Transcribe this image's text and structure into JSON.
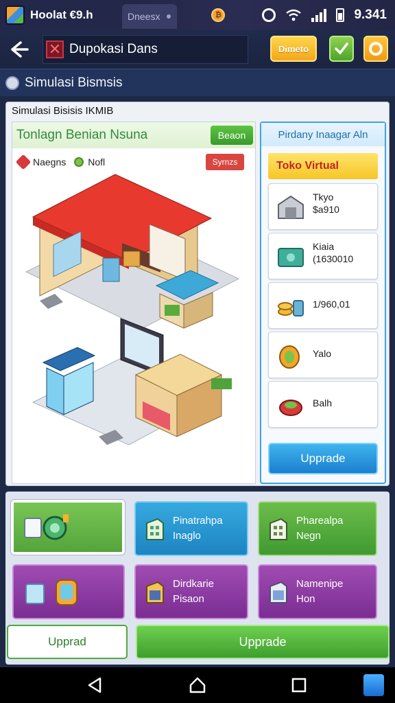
{
  "status_bar": {
    "app_tab_label": "Hoolat €9.h",
    "second_tab_label": "Dneesx",
    "coin_symbol": "₿",
    "clock": "9.341",
    "icons": [
      "coin-icon",
      "ring-icon",
      "wifi-icon",
      "signal-icon",
      "battery-icon"
    ]
  },
  "header": {
    "back_icon": "back-arrow-icon",
    "title": "Dupokasi Dans",
    "yellow_button_label": "Dimeto",
    "green_button_icon": "check-download-icon",
    "orange_button_icon": "settings-icon"
  },
  "section": {
    "title": "Simulasi Bismsis"
  },
  "main_panel": {
    "title": "Simulasi Bisisis IKMIB",
    "scene": {
      "title": "Tonlagn Benian Nsuna",
      "action_button": "Beaon",
      "legend_left": "Naegns",
      "legend_right": "Nofl",
      "badge": "Syrnzs"
    },
    "side": {
      "header": "Pirdany Inaagar Aln",
      "tag": "Toko Virtual",
      "cards": [
        {
          "line1": "Tkyo",
          "line2": "$a910",
          "icon": "warehouse-icon"
        },
        {
          "line1": "Kiaia",
          "line2": "(1630010",
          "icon": "cash-icon"
        },
        {
          "line1": "1/960,01",
          "line2": "",
          "icon": "coins-icon"
        },
        {
          "line1": "Yalo",
          "line2": "",
          "icon": "ring-coin-icon"
        },
        {
          "line1": "Balh",
          "line2": "",
          "icon": "food-icon"
        }
      ],
      "upgrade_label": "Upprade"
    }
  },
  "grid": {
    "tiles": [
      {
        "line1": "",
        "line2": "",
        "icon": "cup-watch-icon",
        "style": "green",
        "selected": true
      },
      {
        "line1": "Pinatrahpa",
        "line2": "Inaglo",
        "icon": "building-icon",
        "style": "blue"
      },
      {
        "line1": "Pharealpa",
        "line2": "Negn",
        "icon": "building-icon",
        "style": "green2"
      },
      {
        "line1": "",
        "line2": "",
        "icon": "glass-device-icon",
        "style": "purple"
      },
      {
        "line1": "Dirdkarie",
        "line2": "Pisaon",
        "icon": "shop-icon",
        "style": "purple"
      },
      {
        "line1": "Namenipe",
        "line2": "Hon",
        "icon": "store-icon",
        "style": "purple"
      }
    ],
    "button_left": "Upprad",
    "button_right": "Upprade"
  },
  "nav": {
    "icons": [
      "nav-back-icon",
      "nav-home-icon",
      "nav-recent-icon",
      "pen-icon"
    ]
  }
}
